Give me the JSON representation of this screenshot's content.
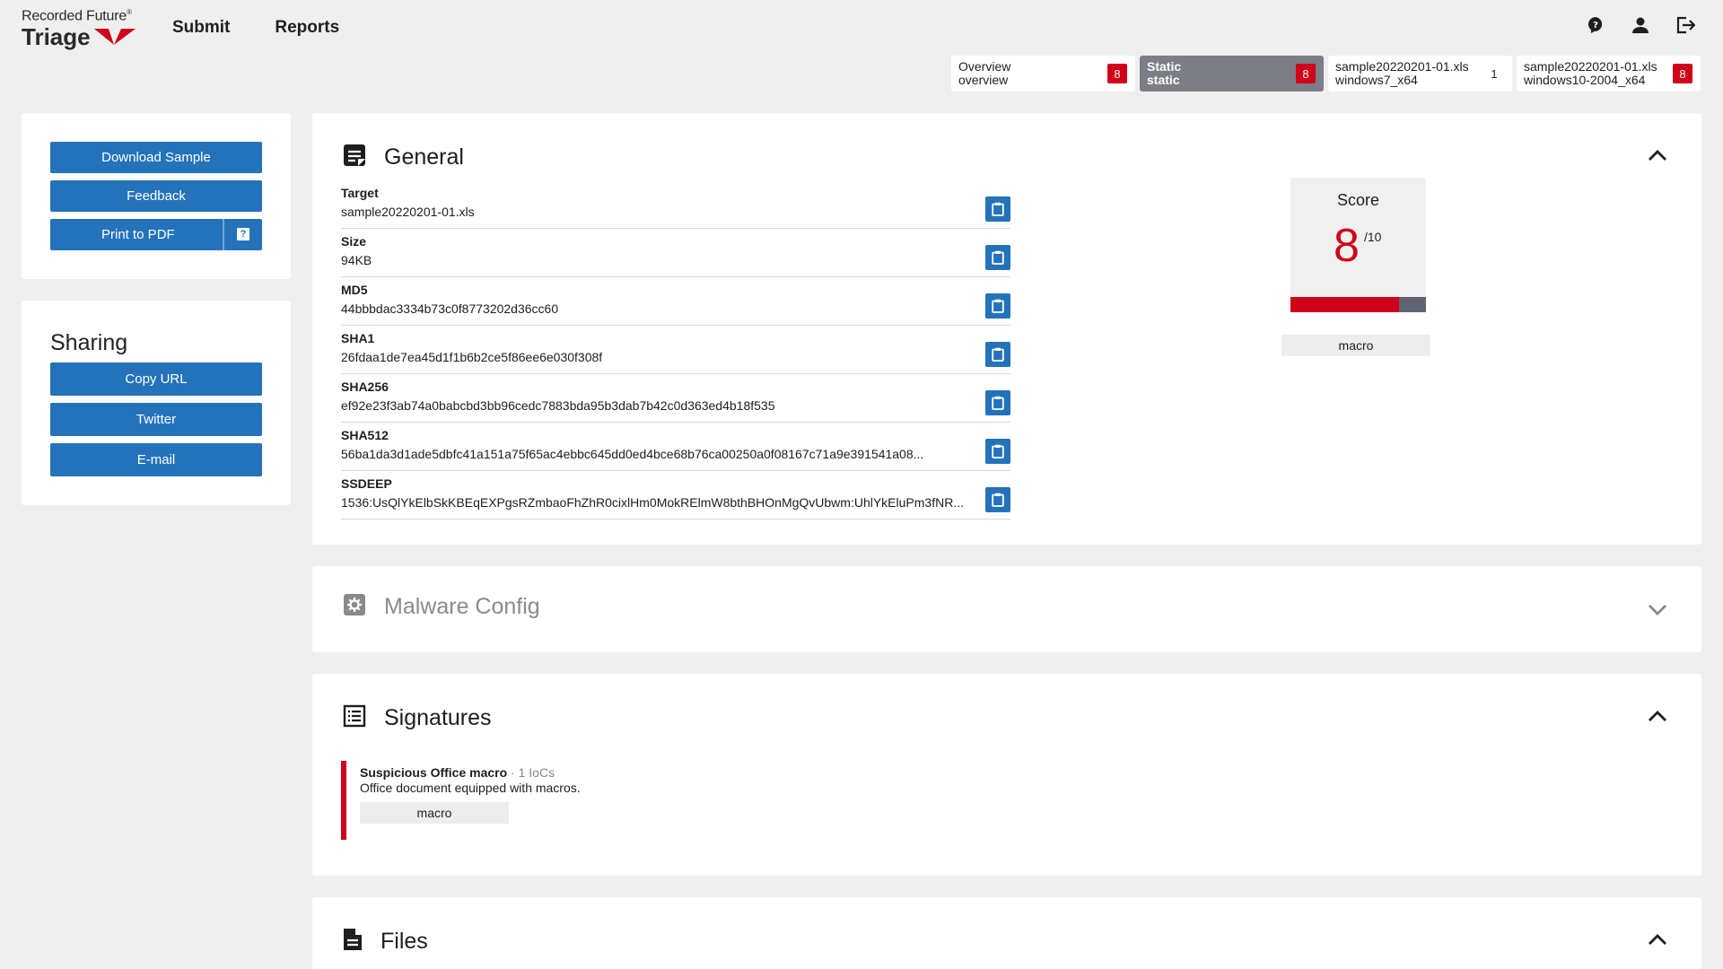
{
  "brand": {
    "company": "Recorded Future",
    "reg": "®",
    "product": "Triage"
  },
  "nav": {
    "submit": "Submit",
    "reports": "Reports"
  },
  "tabs": [
    {
      "line1": "Overview",
      "line2": "overview",
      "badge": "8",
      "badge_style": "red",
      "active": false
    },
    {
      "line1": "Static",
      "line2": "static",
      "badge": "8",
      "badge_style": "red",
      "active": true
    },
    {
      "line1": "sample20220201-01.xls",
      "line2": "windows7_x64",
      "badge": "1",
      "badge_style": "plain",
      "active": false
    },
    {
      "line1": "sample20220201-01.xls",
      "line2": "windows10-2004_x64",
      "badge": "8",
      "badge_style": "red",
      "active": false
    }
  ],
  "actions": {
    "download": "Download Sample",
    "feedback": "Feedback",
    "print": "Print to PDF",
    "print_help": "?"
  },
  "sharing": {
    "title": "Sharing",
    "copy_url": "Copy URL",
    "twitter": "Twitter",
    "email": "E-mail"
  },
  "general": {
    "title": "General",
    "fields": [
      {
        "label": "Target",
        "value": "sample20220201-01.xls"
      },
      {
        "label": "Size",
        "value": "94KB"
      },
      {
        "label": "MD5",
        "value": "44bbbdac3334b73c0f8773202d36cc60"
      },
      {
        "label": "SHA1",
        "value": "26fdaa1de7ea45d1f1b6b2ce5f86ee6e030f308f"
      },
      {
        "label": "SHA256",
        "value": "ef92e23f3ab74a0babcbd3bb96cedc7883bda95b3dab7b42c0d363ed4b18f535"
      },
      {
        "label": "SHA512",
        "value": "56ba1da3d1ade5dbfc41a151a75f65ac4ebbc645dd0ed4bce68b76ca00250a0f08167c71a9e391541a08..."
      },
      {
        "label": "SSDEEP",
        "value": "1536:UsQlYkElbSkKBEqEXPgsRZmbaoFhZhR0cixlHm0MokRElmW8bthBHOnMgQvUbwm:UhlYkEluPm3fNR..."
      }
    ],
    "score": {
      "label": "Score",
      "value": "8",
      "max": "/10",
      "fraction": 0.8
    },
    "tag": "macro"
  },
  "malware_config": {
    "title": "Malware Config"
  },
  "signatures": {
    "title": "Signatures",
    "items": [
      {
        "name": "Suspicious Office macro",
        "meta": " · 1 IoCs",
        "description": "Office document equipped with macros.",
        "tag": "macro"
      }
    ]
  },
  "files": {
    "title": "Files"
  },
  "colors": {
    "accent_blue": "#2473ba",
    "danger_red": "#d0021b",
    "tab_active": "#7b7e85",
    "background": "#efefef"
  },
  "icons": {
    "help": "help-bubble-icon",
    "account": "account-icon",
    "logout": "logout-icon",
    "general": "note-icon",
    "malware": "gear-box-icon",
    "signatures": "list-icon",
    "files": "file-icon",
    "copy": "clipboard-icon"
  }
}
